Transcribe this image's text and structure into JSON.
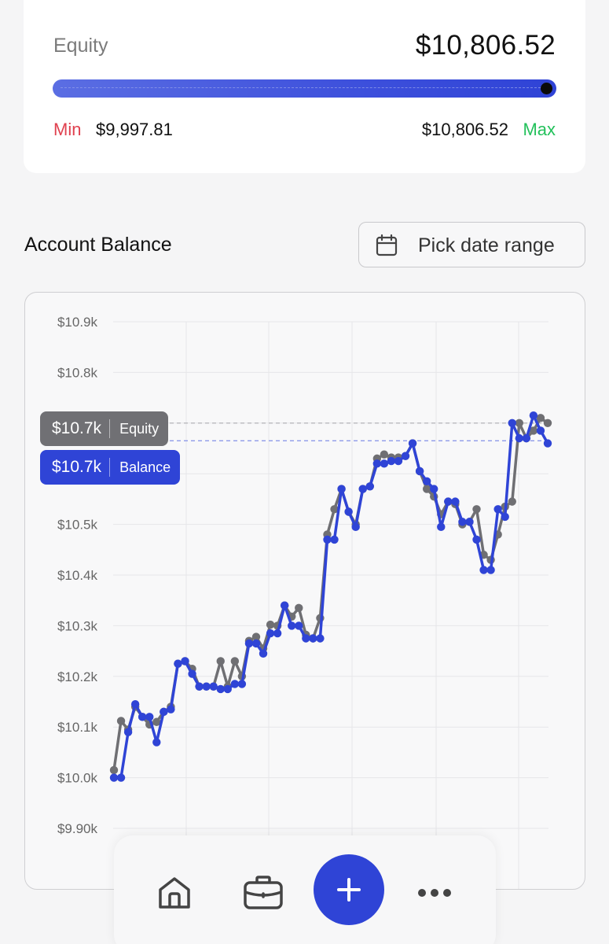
{
  "equity": {
    "label": "Equity",
    "value": "$10,806.52",
    "progress_fraction": 1.0,
    "min_label": "Min",
    "min_value": "$9,997.81",
    "max_value": "$10,806.52",
    "max_label": "Max"
  },
  "account": {
    "title": "Account Balance",
    "date_button": "Pick date range"
  },
  "tooltip": {
    "equity_value": "$10.7k",
    "equity_name": "Equity",
    "balance_value": "$10.7k",
    "balance_name": "Balance"
  },
  "chart_data": {
    "type": "line",
    "y_ticks": [
      10900,
      10800,
      10700,
      10600,
      10500,
      10400,
      10300,
      10200,
      10100,
      10000,
      9900
    ],
    "y_tick_labels": [
      "$10.9k",
      "$10.8k",
      "$10.7k",
      "$10.6k",
      "$10.5k",
      "$10.4k",
      "$10.3k",
      "$10.2k",
      "$10.1k",
      "$10.0k",
      "$9.90k"
    ],
    "ylim": [
      9900,
      10900
    ],
    "grid": true,
    "colors": {
      "Equity": "#6f6f73",
      "Balance": "#2f44d6"
    },
    "series": [
      {
        "name": "Equity",
        "values": [
          10015,
          10112,
          10095,
          10140,
          10120,
          10105,
          10110,
          10130,
          10140,
          10225,
          10230,
          10215,
          10180,
          10180,
          10180,
          10230,
          10180,
          10230,
          10200,
          10270,
          10278,
          10255,
          10302,
          10300,
          10340,
          10318,
          10335,
          10282,
          10275,
          10315,
          10480,
          10530,
          10570,
          10525,
          10500,
          10570,
          10575,
          10630,
          10638,
          10632,
          10632,
          10635,
          10660,
          10605,
          10570,
          10555,
          10520,
          10545,
          10540,
          10500,
          10505,
          10530,
          10440,
          10430,
          10480,
          10535,
          10545,
          10700,
          10670,
          10685,
          10710,
          10700
        ]
      },
      {
        "name": "Balance",
        "values": [
          10000,
          10000,
          10090,
          10145,
          10120,
          10120,
          10070,
          10130,
          10135,
          10225,
          10230,
          10205,
          10180,
          10180,
          10180,
          10175,
          10175,
          10185,
          10185,
          10265,
          10265,
          10245,
          10285,
          10285,
          10340,
          10300,
          10300,
          10275,
          10275,
          10275,
          10470,
          10470,
          10570,
          10525,
          10495,
          10570,
          10575,
          10620,
          10620,
          10625,
          10625,
          10635,
          10660,
          10605,
          10585,
          10570,
          10495,
          10545,
          10545,
          10505,
          10505,
          10470,
          10410,
          10410,
          10530,
          10515,
          10700,
          10670,
          10670,
          10715,
          10685,
          10660
        ]
      }
    ],
    "reference_values": [
      10700,
      10665
    ]
  },
  "nav": {
    "items": [
      {
        "name": "home-icon"
      },
      {
        "name": "briefcase-icon"
      },
      {
        "name": "plus-icon"
      },
      {
        "name": "more-icon"
      }
    ]
  }
}
